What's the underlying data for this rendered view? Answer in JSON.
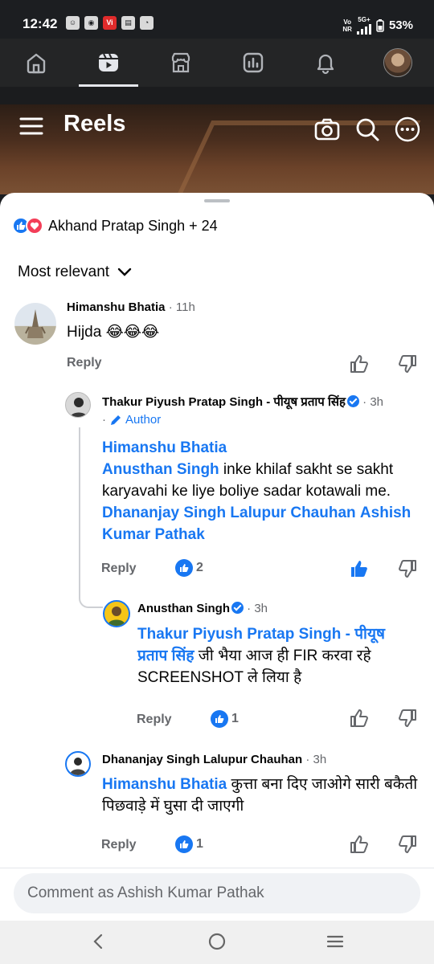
{
  "status_bar": {
    "time": "12:42",
    "network_top": "Vo",
    "network_bottom": "NR",
    "signal_type": "5G+",
    "battery": "53%"
  },
  "top_nav": {
    "tabs": [
      "home-icon",
      "reels-icon",
      "marketplace-icon",
      "news-feed-icon",
      "notifications-icon",
      "profile-avatar"
    ],
    "active_tab": "reels-icon"
  },
  "reels_header": {
    "title": "Reels"
  },
  "sheet": {
    "reactions_summary": "Akhand Pratap Singh + 24",
    "sort_label": "Most relevant",
    "comments": [
      {
        "name": "Himanshu Bhatia",
        "time": "11h",
        "text": "Hijda 😂😂😂",
        "reply_label": "Reply"
      },
      {
        "name": "Thakur Piyush Pratap Singh - पीयूष प्रताप सिंह",
        "time": "3h",
        "author_badge": "Author",
        "mention1": "Himanshu Bhatia",
        "mention2": "Anusthan Singh",
        "text_mid": " inke khilaf sakht se sakht karyavahi ke liye boliye sadar kotawali me. ",
        "mention3": "Dhananjay Singh Lalupur Chauhan",
        "mention4": "Ashish Kumar Pathak",
        "reply_label": "Reply",
        "like_count": "2"
      },
      {
        "name": "Anusthan Singh",
        "time": "3h",
        "mention1": "Thakur Piyush Pratap Singh - पीयूष प्रताप सिंह",
        "text_rest": " जी भैया आज ही FIR करवा रहे SCREENSHOT ले लिया है",
        "reply_label": "Reply",
        "like_count": "1"
      },
      {
        "name": "Dhananjay Singh Lalupur Chauhan",
        "time": "3h",
        "mention1": "Himanshu Bhatia",
        "text_rest": " कुत्ता बना दिए जाओगे सारी बकैती पिछवाड़े में घुसा दी जाएगी",
        "reply_label": "Reply",
        "like_count": "1"
      }
    ]
  },
  "comment_input": {
    "placeholder": "Comment as Ashish Kumar Pathak"
  },
  "colors": {
    "accent": "#1877f2",
    "love": "#f33e58",
    "muted": "#65676b"
  }
}
